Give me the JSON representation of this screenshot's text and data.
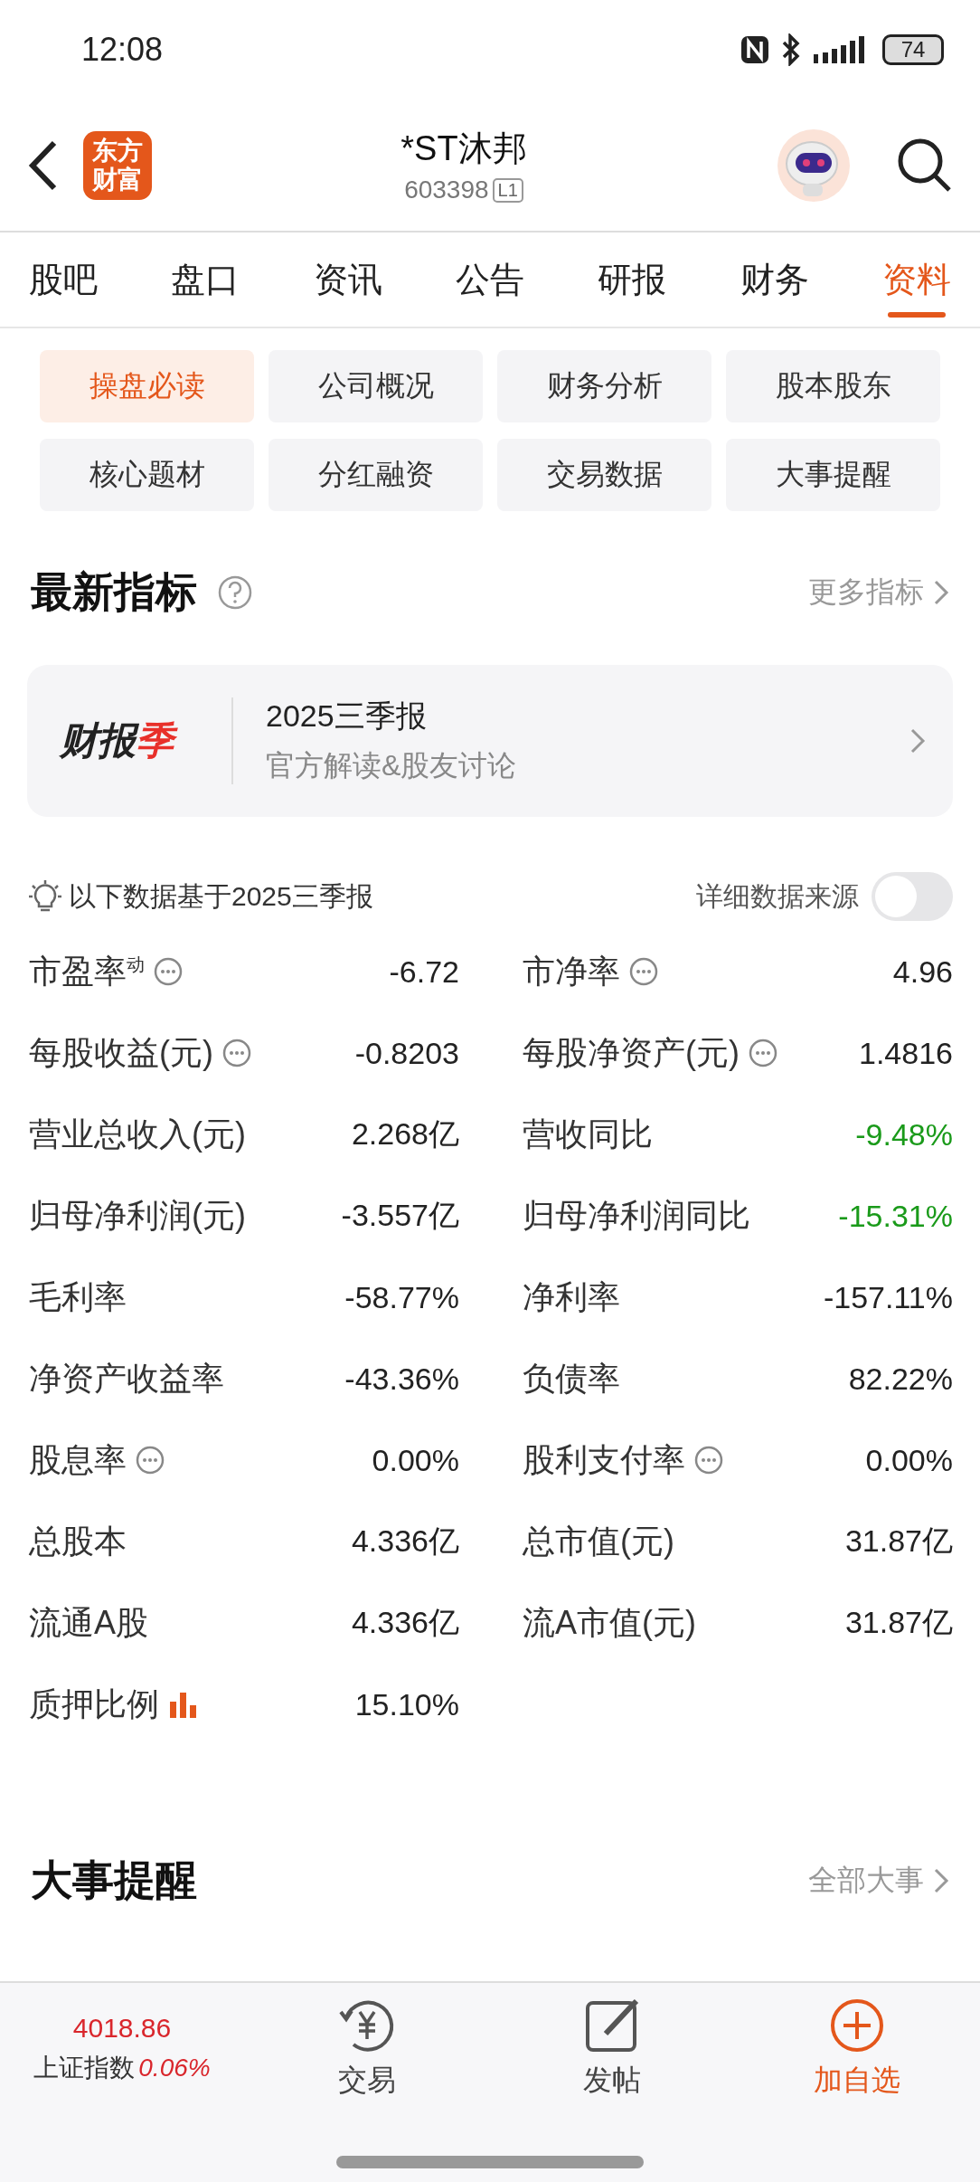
{
  "status_bar": {
    "time": "12:08",
    "battery": "74"
  },
  "header": {
    "logo": "东方财富",
    "title": "*ST沐邦",
    "code": "603398",
    "badge": "L1"
  },
  "tabs": [
    {
      "label": "股吧",
      "selected": false
    },
    {
      "label": "盘口",
      "selected": false
    },
    {
      "label": "资讯",
      "selected": false
    },
    {
      "label": "公告",
      "selected": false
    },
    {
      "label": "研报",
      "selected": false
    },
    {
      "label": "财务",
      "selected": false
    },
    {
      "label": "资料",
      "selected": true
    }
  ],
  "sub_tabs": [
    {
      "label": "操盘必读",
      "selected": true
    },
    {
      "label": "公司概况",
      "selected": false
    },
    {
      "label": "财务分析",
      "selected": false
    },
    {
      "label": "股本股东",
      "selected": false
    },
    {
      "label": "核心题材",
      "selected": false
    },
    {
      "label": "分红融资",
      "selected": false
    },
    {
      "label": "交易数据",
      "selected": false
    },
    {
      "label": "大事提醒",
      "selected": false
    }
  ],
  "latest_indicators": {
    "title": "最新指标",
    "more": "更多指标",
    "report_card": {
      "logo": "财报",
      "logo_accent": "季",
      "title": "2025三季报",
      "subtitle": "官方解读&股友讨论"
    },
    "note": "以下数据基于2025三季报",
    "source_toggle": {
      "label": "详细数据来源",
      "on": false
    },
    "metrics": [
      {
        "label": "市盈率$^{动}$",
        "kind": "info",
        "value": "-6.72",
        "color": "#222222"
      },
      {
        "label": "市净率",
        "kind": "info",
        "value": "4.96",
        "color": "#222222"
      },
      {
        "label": "每股收益(元)",
        "kind": "info",
        "value": "-0.8203",
        "color": "#222222"
      },
      {
        "label": "每股净资产(元)",
        "kind": "info",
        "value": "1.4816",
        "color": "#222222"
      },
      {
        "label": "营业总收入(元)",
        "kind": "plain",
        "value": "2.268亿",
        "color": "#222222"
      },
      {
        "label": "营收同比",
        "kind": "plain",
        "value": "-9.48%",
        "color": "#1a9a1a"
      },
      {
        "label": "归母净利润(元)",
        "kind": "plain",
        "value": "-3.557亿",
        "color": "#222222"
      },
      {
        "label": "归母净利润同比",
        "kind": "plain",
        "value": "-15.31%",
        "color": "#1a9a1a"
      },
      {
        "label": "毛利率",
        "kind": "plain",
        "value": "-58.77%",
        "color": "#222222"
      },
      {
        "label": "净利率",
        "kind": "plain",
        "value": "-157.11%",
        "color": "#222222"
      },
      {
        "label": "净资产收益率",
        "kind": "plain",
        "value": "-43.36%",
        "color": "#222222"
      },
      {
        "label": "负债率",
        "kind": "plain",
        "value": "82.22%",
        "color": "#222222"
      },
      {
        "label": "股息率",
        "kind": "info",
        "value": "0.00%",
        "color": "#222222"
      },
      {
        "label": "股利支付率",
        "kind": "info",
        "value": "0.00%",
        "color": "#222222"
      },
      {
        "label": "总股本",
        "kind": "plain",
        "value": "4.336亿",
        "color": "#222222"
      },
      {
        "label": "总市值(元)",
        "kind": "plain",
        "value": "31.87亿",
        "color": "#222222"
      },
      {
        "label": "流通A股",
        "kind": "plain",
        "value": "4.336亿",
        "color": "#222222"
      },
      {
        "label": "流A市值(元)",
        "kind": "plain",
        "value": "31.87亿",
        "color": "#222222"
      },
      {
        "label": "质押比例",
        "kind": "chart",
        "value": "15.10%",
        "color": "#222222"
      }
    ]
  },
  "events": {
    "title": "大事提醒",
    "more": "全部大事"
  },
  "bottom_bar": {
    "index_value": "4018.86",
    "index_name": "上证指数",
    "index_change": "0.06%",
    "actions": [
      {
        "label": "交易",
        "kind": "trade",
        "accent": false
      },
      {
        "label": "发帖",
        "kind": "post",
        "accent": false
      },
      {
        "label": "加自选",
        "kind": "add",
        "accent": true
      }
    ]
  }
}
